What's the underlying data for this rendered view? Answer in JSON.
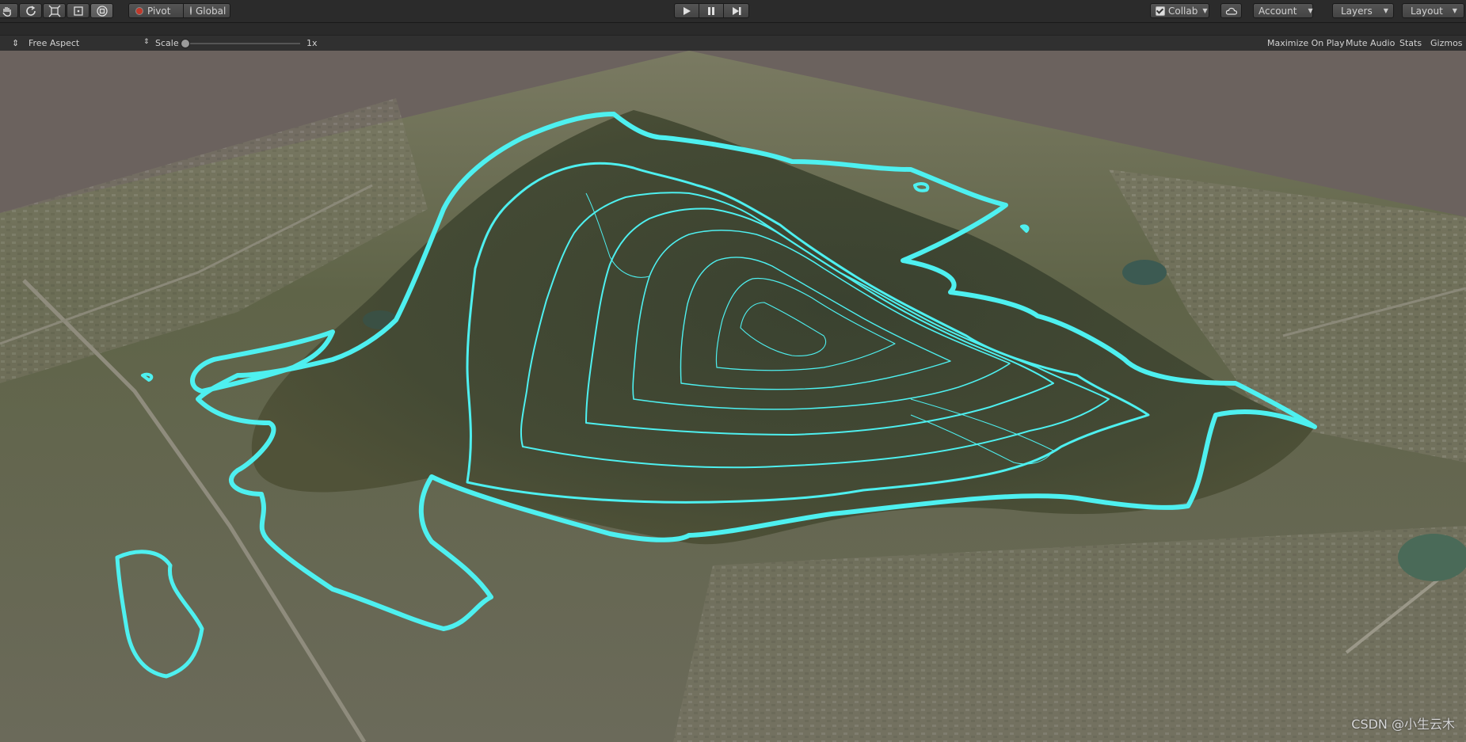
{
  "toolbar": {
    "tools": [
      {
        "name": "hand-tool-icon"
      },
      {
        "name": "rotate-tool-icon"
      },
      {
        "name": "scale-tool-icon"
      },
      {
        "name": "rect-tool-icon"
      },
      {
        "name": "transform-tool-icon"
      }
    ],
    "pivot_label": "Pivot",
    "global_label": "Global",
    "collab_label": "Collab",
    "account_label": "Account",
    "layers_label": "Layers",
    "layout_label": "Layout"
  },
  "gamebar": {
    "aspect_label": "Free Aspect",
    "scale_label": "Scale",
    "scale_value": "1x",
    "scale_fraction": 0.0,
    "maximize_label": "Maximize On Play",
    "mute_label": "Mute Audio",
    "stats_label": "Stats",
    "gizmos_label": "Gizmos"
  },
  "viewport": {
    "contour_color": "#4ef0f0",
    "watermark": "CSDN @小生云木"
  }
}
